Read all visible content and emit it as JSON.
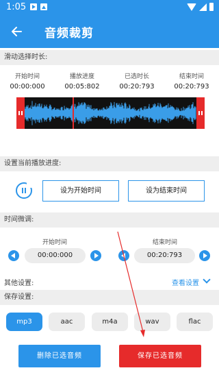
{
  "status_bar": {
    "time": "1:05"
  },
  "app_bar": {
    "title": "音频裁剪"
  },
  "sections": {
    "duration": "滑动选择时长:",
    "progress": "设置当前播放进度:",
    "fine_tune": "时间微调:",
    "other": "其他设置:",
    "save": "保存设置:"
  },
  "time_info": [
    {
      "label": "开始时间",
      "value": "00:00:000"
    },
    {
      "label": "播放进度",
      "value": "00:05:802"
    },
    {
      "label": "已选时长",
      "value": "00:20:793"
    },
    {
      "label": "结束时间",
      "value": "00:20:793"
    }
  ],
  "buttons": {
    "set_start": "设为开始时间",
    "set_end": "设为结束时间",
    "delete": "删除已选音频",
    "save": "保存已选音频"
  },
  "fine_tune": {
    "start_label": "开始时间",
    "start_value": "00:00:000",
    "end_label": "结束时间",
    "end_value": "00:20:793"
  },
  "other": {
    "link": "查看设置"
  },
  "formats": [
    "mp3",
    "aac",
    "m4a",
    "wav",
    "flac"
  ],
  "selected_format": "mp3",
  "playback_progress": 0.279,
  "colors": {
    "primary": "#2b94e9",
    "accent_red": "#e62b2b",
    "waveform": "#3a9de8"
  }
}
